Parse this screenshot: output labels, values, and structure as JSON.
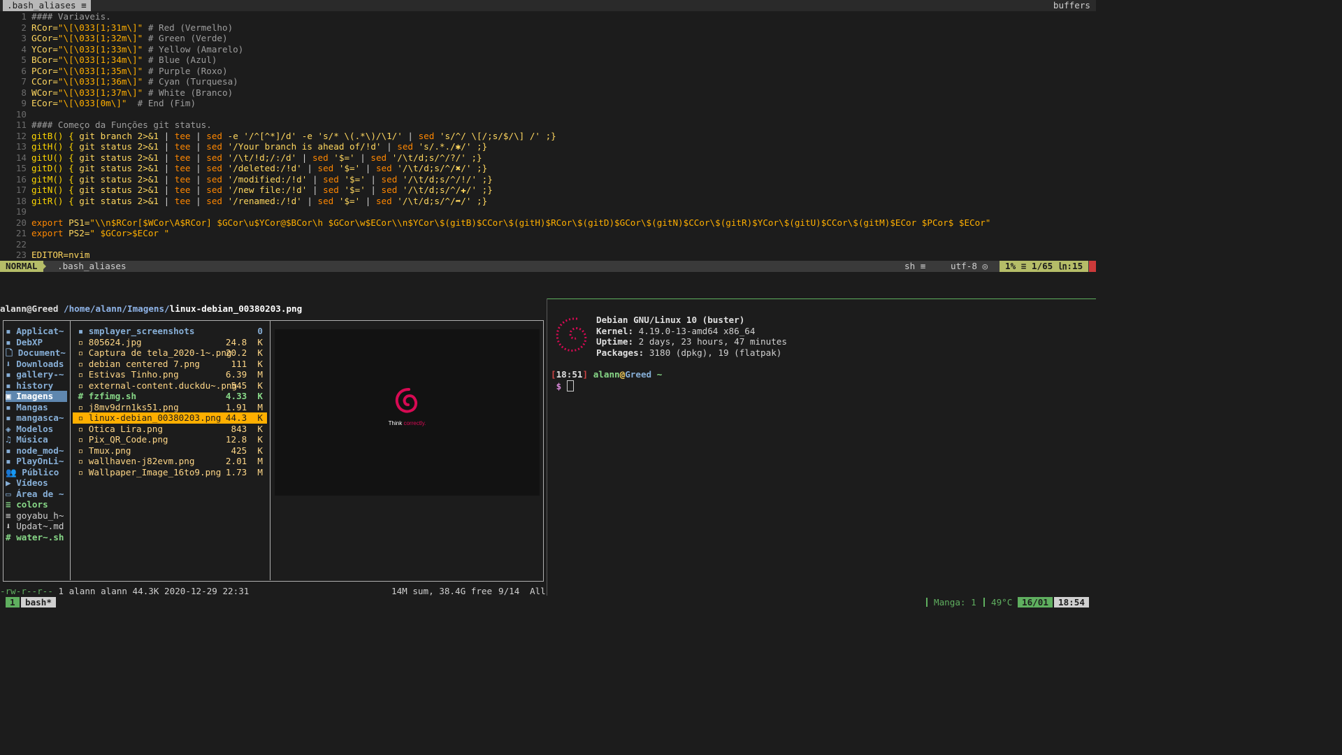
{
  "tabline": {
    "active_tab": ".bash_aliases",
    "right_label": "buffers"
  },
  "editor": {
    "lines": [
      {
        "n": "1",
        "segs": [
          {
            "t": "#### Variaveis.",
            "c": "cm"
          }
        ]
      },
      {
        "n": "2",
        "segs": [
          {
            "t": "RCor=",
            "c": "var"
          },
          {
            "t": "\"\\[\\033[1;31m\\]\"",
            "c": "str"
          },
          {
            "t": " # Red (Vermelho)",
            "c": "cm"
          }
        ]
      },
      {
        "n": "3",
        "segs": [
          {
            "t": "GCor=",
            "c": "var"
          },
          {
            "t": "\"\\[\\033[1;32m\\]\"",
            "c": "str"
          },
          {
            "t": " # Green (Verde)",
            "c": "cm"
          }
        ]
      },
      {
        "n": "4",
        "segs": [
          {
            "t": "YCor=",
            "c": "var"
          },
          {
            "t": "\"\\[\\033[1;33m\\]\"",
            "c": "str"
          },
          {
            "t": " # Yellow (Amarelo)",
            "c": "cm"
          }
        ]
      },
      {
        "n": "5",
        "segs": [
          {
            "t": "BCor=",
            "c": "var"
          },
          {
            "t": "\"\\[\\033[1;34m\\]\"",
            "c": "str"
          },
          {
            "t": " # Blue (Azul)",
            "c": "cm"
          }
        ]
      },
      {
        "n": "6",
        "segs": [
          {
            "t": "PCor=",
            "c": "var"
          },
          {
            "t": "\"\\[\\033[1;35m\\]\"",
            "c": "str"
          },
          {
            "t": " # Purple (Roxo)",
            "c": "cm"
          }
        ]
      },
      {
        "n": "7",
        "segs": [
          {
            "t": "CCor=",
            "c": "var"
          },
          {
            "t": "\"\\[\\033[1;36m\\]\"",
            "c": "str"
          },
          {
            "t": " # Cyan (Turquesa)",
            "c": "cm"
          }
        ]
      },
      {
        "n": "8",
        "segs": [
          {
            "t": "WCor=",
            "c": "var"
          },
          {
            "t": "\"\\[\\033[1;37m\\]\"",
            "c": "str"
          },
          {
            "t": " # White (Branco)",
            "c": "cm"
          }
        ]
      },
      {
        "n": "9",
        "segs": [
          {
            "t": "ECor=",
            "c": "var"
          },
          {
            "t": "\"\\[\\033[0m\\]\"",
            "c": "str"
          },
          {
            "t": "  # End (Fim)",
            "c": "cm"
          }
        ]
      },
      {
        "n": "10",
        "segs": []
      },
      {
        "n": "11",
        "segs": [
          {
            "t": "#### Começo da Funções git status.",
            "c": "cm"
          }
        ]
      },
      {
        "n": "12",
        "segs": [
          {
            "t": "gitB() { ",
            "c": "fn"
          },
          {
            "t": "git branch 2>&1 ",
            "c": "var"
          },
          {
            "t": "| ",
            "c": "sep"
          },
          {
            "t": "tee ",
            "c": "kw"
          },
          {
            "t": "| ",
            "c": "sep"
          },
          {
            "t": "sed ",
            "c": "kw"
          },
          {
            "t": "-e '/^[^*]/d' -e 's/* \\(.*\\)/\\1/' ",
            "c": "var"
          },
          {
            "t": "| ",
            "c": "sep"
          },
          {
            "t": "sed ",
            "c": "kw"
          },
          {
            "t": "'s/^/ \\[/;s/$/\\] /' ;}",
            "c": "var"
          }
        ]
      },
      {
        "n": "13",
        "segs": [
          {
            "t": "gitH() { ",
            "c": "fn"
          },
          {
            "t": "git status 2>&1 ",
            "c": "var"
          },
          {
            "t": "| ",
            "c": "sep"
          },
          {
            "t": "tee ",
            "c": "kw"
          },
          {
            "t": "| ",
            "c": "sep"
          },
          {
            "t": "sed ",
            "c": "kw"
          },
          {
            "t": "'/Your branch is ahead of/!d' ",
            "c": "var"
          },
          {
            "t": "| ",
            "c": "sep"
          },
          {
            "t": "sed ",
            "c": "kw"
          },
          {
            "t": "'s/.*./✱/' ;}",
            "c": "var"
          }
        ]
      },
      {
        "n": "14",
        "segs": [
          {
            "t": "gitU() { ",
            "c": "fn"
          },
          {
            "t": "git status 2>&1 ",
            "c": "var"
          },
          {
            "t": "| ",
            "c": "sep"
          },
          {
            "t": "tee ",
            "c": "kw"
          },
          {
            "t": "| ",
            "c": "sep"
          },
          {
            "t": "sed ",
            "c": "kw"
          },
          {
            "t": "'/\\t/!d;/:/d' ",
            "c": "var"
          },
          {
            "t": "| ",
            "c": "sep"
          },
          {
            "t": "sed ",
            "c": "kw"
          },
          {
            "t": "'$=' ",
            "c": "var"
          },
          {
            "t": "| ",
            "c": "sep"
          },
          {
            "t": "sed ",
            "c": "kw"
          },
          {
            "t": "'/\\t/d;s/^/?/' ;}",
            "c": "var"
          }
        ]
      },
      {
        "n": "15",
        "segs": [
          {
            "t": "gitD() { ",
            "c": "fn"
          },
          {
            "t": "git status 2>&1 ",
            "c": "var"
          },
          {
            "t": "| ",
            "c": "sep"
          },
          {
            "t": "tee ",
            "c": "kw"
          },
          {
            "t": "| ",
            "c": "sep"
          },
          {
            "t": "sed ",
            "c": "kw"
          },
          {
            "t": "'/deleted:/!d' ",
            "c": "var"
          },
          {
            "t": "| ",
            "c": "sep"
          },
          {
            "t": "sed ",
            "c": "kw"
          },
          {
            "t": "'$=' ",
            "c": "var"
          },
          {
            "t": "| ",
            "c": "sep"
          },
          {
            "t": "sed ",
            "c": "kw"
          },
          {
            "t": "'/\\t/d;s/^/✖/' ;}",
            "c": "var"
          }
        ]
      },
      {
        "n": "16",
        "segs": [
          {
            "t": "gitM() { ",
            "c": "fn"
          },
          {
            "t": "git status 2>&1 ",
            "c": "var"
          },
          {
            "t": "| ",
            "c": "sep"
          },
          {
            "t": "tee ",
            "c": "kw"
          },
          {
            "t": "| ",
            "c": "sep"
          },
          {
            "t": "sed ",
            "c": "kw"
          },
          {
            "t": "'/modified:/!d' ",
            "c": "var"
          },
          {
            "t": "| ",
            "c": "sep"
          },
          {
            "t": "sed ",
            "c": "kw"
          },
          {
            "t": "'$=' ",
            "c": "var"
          },
          {
            "t": "| ",
            "c": "sep"
          },
          {
            "t": "sed ",
            "c": "kw"
          },
          {
            "t": "'/\\t/d;s/^/!/' ;}",
            "c": "var"
          }
        ]
      },
      {
        "n": "17",
        "segs": [
          {
            "t": "gitN() { ",
            "c": "fn"
          },
          {
            "t": "git status 2>&1 ",
            "c": "var"
          },
          {
            "t": "| ",
            "c": "sep"
          },
          {
            "t": "tee ",
            "c": "kw"
          },
          {
            "t": "| ",
            "c": "sep"
          },
          {
            "t": "sed ",
            "c": "kw"
          },
          {
            "t": "'/new file:/!d' ",
            "c": "var"
          },
          {
            "t": "| ",
            "c": "sep"
          },
          {
            "t": "sed ",
            "c": "kw"
          },
          {
            "t": "'$=' ",
            "c": "var"
          },
          {
            "t": "| ",
            "c": "sep"
          },
          {
            "t": "sed ",
            "c": "kw"
          },
          {
            "t": "'/\\t/d;s/^/✚/' ;}",
            "c": "var"
          }
        ]
      },
      {
        "n": "18",
        "segs": [
          {
            "t": "gitR() { ",
            "c": "fn"
          },
          {
            "t": "git status 2>&1 ",
            "c": "var"
          },
          {
            "t": "| ",
            "c": "sep"
          },
          {
            "t": "tee ",
            "c": "kw"
          },
          {
            "t": "| ",
            "c": "sep"
          },
          {
            "t": "sed ",
            "c": "kw"
          },
          {
            "t": "'/renamed:/!d' ",
            "c": "var"
          },
          {
            "t": "| ",
            "c": "sep"
          },
          {
            "t": "sed ",
            "c": "kw"
          },
          {
            "t": "'$=' ",
            "c": "var"
          },
          {
            "t": "| ",
            "c": "sep"
          },
          {
            "t": "sed ",
            "c": "kw"
          },
          {
            "t": "'/\\t/d;s/^/➦/' ;}",
            "c": "var"
          }
        ]
      },
      {
        "n": "19",
        "segs": []
      },
      {
        "n": "20",
        "segs": [
          {
            "t": "export ",
            "c": "kw"
          },
          {
            "t": "PS1=",
            "c": "var"
          },
          {
            "t": "\"\\\\n$RCor[$WCor\\A$RCor] $GCor\\u$YCor@$BCor\\h $GCor\\w$ECor\\\\n$YCor\\$(gitB)$CCor\\$(gitH)$RCor\\$(gitD)$GCor\\$(gitN)$CCor\\$(gitR)$YCor\\$(gitU)$CCor\\$(gitM)$ECor $PCor$ $ECor\"",
            "c": "str"
          }
        ]
      },
      {
        "n": "21",
        "segs": [
          {
            "t": "export ",
            "c": "kw"
          },
          {
            "t": "PS2=",
            "c": "var"
          },
          {
            "t": "\" $GCor>$ECor \"",
            "c": "str"
          }
        ]
      },
      {
        "n": "22",
        "segs": []
      },
      {
        "n": "23",
        "segs": [
          {
            "t": "EDITOR=nvim",
            "c": "var"
          }
        ]
      }
    ]
  },
  "statusline": {
    "mode": "NORMAL",
    "file": ".bash_aliases",
    "filetype": "sh ≡",
    "encoding": "utf-8 ◎",
    "position": "1% ≡ 1/65 ㏑:15"
  },
  "ranger": {
    "user": "alann@Greed",
    "path": "/home/alann/Imagens/",
    "selected_file": "linux-debian_00380203.png",
    "parent_items": [
      {
        "icon": "▪",
        "label": "Applicat~",
        "kind": "dir"
      },
      {
        "icon": "▪",
        "label": "DebXP",
        "kind": "dir"
      },
      {
        "icon": "🗋",
        "label": "Document~",
        "kind": "dir"
      },
      {
        "icon": "⬇",
        "label": "Downloads",
        "kind": "dir"
      },
      {
        "icon": "▪",
        "label": "gallery-~",
        "kind": "dir"
      },
      {
        "icon": "▪",
        "label": "history",
        "kind": "dir"
      },
      {
        "icon": "▣",
        "label": "Imagens",
        "kind": "sel"
      },
      {
        "icon": "▪",
        "label": "Mangas",
        "kind": "dir"
      },
      {
        "icon": "▪",
        "label": "mangasca~",
        "kind": "dir"
      },
      {
        "icon": "◈",
        "label": "Modelos",
        "kind": "dir"
      },
      {
        "icon": "♫",
        "label": "Música",
        "kind": "dir"
      },
      {
        "icon": "▪",
        "label": "node_mod~",
        "kind": "dir"
      },
      {
        "icon": "▪",
        "label": "PlayOnLi~",
        "kind": "dir"
      },
      {
        "icon": "👥",
        "label": "Público",
        "kind": "dir"
      },
      {
        "icon": "▶",
        "label": "Vídeos",
        "kind": "dir"
      },
      {
        "icon": "▭",
        "label": "Área de ~",
        "kind": "dir"
      },
      {
        "icon": "≡",
        "label": "colors",
        "kind": "green"
      },
      {
        "icon": "≡",
        "label": "goyabu_h~",
        "kind": "file"
      },
      {
        "icon": "⬇",
        "label": "Updat~.md",
        "kind": "file"
      },
      {
        "icon": "#",
        "label": "water~.sh",
        "kind": "green"
      }
    ],
    "files": [
      {
        "icon": "▪",
        "name": "smplayer_screenshots",
        "size": "0",
        "kind": "dir"
      },
      {
        "icon": "▫",
        "name": "805624.jpg",
        "size": "24.8  K",
        "kind": "img"
      },
      {
        "icon": "▫",
        "name": "Captura de tela_2020-1~.png",
        "size": "20.2  K",
        "kind": "img"
      },
      {
        "icon": "▫",
        "name": "debian centered 7.png",
        "size": "111  K",
        "kind": "img"
      },
      {
        "icon": "▫",
        "name": "Estivas Tinho.png",
        "size": "6.39  M",
        "kind": "img"
      },
      {
        "icon": "▫",
        "name": "external-content.duckdu~.png",
        "size": "545  K",
        "kind": "img"
      },
      {
        "icon": "#",
        "name": "fzfimg.sh",
        "size": "4.33  K",
        "kind": "exe"
      },
      {
        "icon": "▫",
        "name": "j8mv9drn1ks51.png",
        "size": "1.91  M",
        "kind": "img"
      },
      {
        "icon": "▫",
        "name": "linux-debian_00380203.png",
        "size": "44.3  K",
        "kind": "sel"
      },
      {
        "icon": "▫",
        "name": "Otica Lira.png",
        "size": "843  K",
        "kind": "img"
      },
      {
        "icon": "▫",
        "name": "Pix_QR_Code.png",
        "size": "12.8  K",
        "kind": "img"
      },
      {
        "icon": "▫",
        "name": "Tmux.png",
        "size": "425  K",
        "kind": "img"
      },
      {
        "icon": "▫",
        "name": "wallhaven-j82evm.png",
        "size": "2.01  M",
        "kind": "img"
      },
      {
        "icon": "▫",
        "name": "Wallpaper_Image_16to9.png",
        "size": "1.73  M",
        "kind": "img"
      }
    ],
    "preview": {
      "text_plain": "Think ",
      "text_accent": "correctly."
    },
    "footer": {
      "perms": "-rw-r--r--",
      "info": " 1 alann alann 44.3K 2020-12-29 22:31",
      "disk": "14M sum, 38.4G free",
      "count": "9/14",
      "scroll": "All"
    }
  },
  "neofetch": {
    "os": "Debian GNU/Linux 10 (buster)",
    "kernel_label": "Kernel:",
    "kernel": " 4.19.0-13-amd64 x86_64",
    "uptime_label": "Uptime:",
    "uptime": " 2 days, 23 hours, 47 minutes",
    "packages_label": "Packages:",
    "packages": " 3180 (dpkg), 19 (flatpak)"
  },
  "prompt": {
    "time": "18:51",
    "user": "alann",
    "at": "@",
    "host": "Greed",
    "dir": " ~",
    "symbol": " $ "
  },
  "tmux": {
    "index": "1",
    "window": "bash*",
    "manga": "Manga: 1",
    "temp": "49°C",
    "date": "16/01",
    "time": "18:54"
  },
  "colors": {
    "accent_green": "#5faf5f",
    "mode_green": "#b5bd68",
    "selection_orange": "#ffaf00",
    "debian_red": "#d70a53"
  }
}
